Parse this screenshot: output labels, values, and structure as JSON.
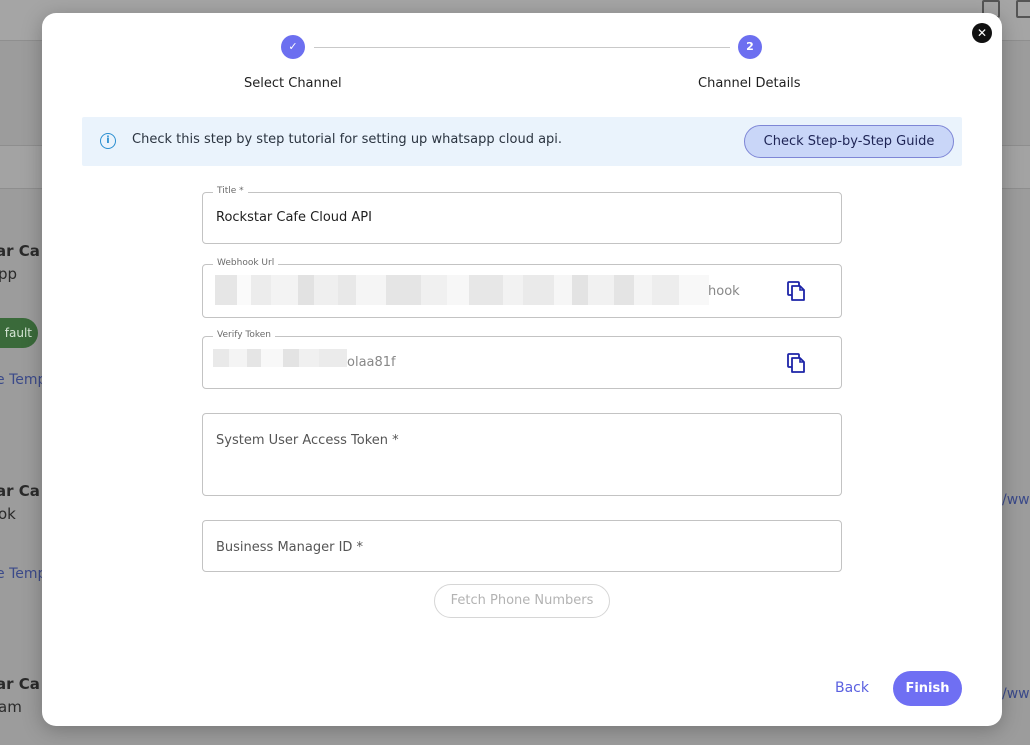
{
  "background": {
    "cards": [
      {
        "title": "ar Ca",
        "subtitle": "pp",
        "link": "e Temp",
        "badge": "fault"
      },
      {
        "title": "ar Ca",
        "subtitle": "ok",
        "link": "e Temp",
        "right_link": "/www"
      },
      {
        "title": "ar Ca",
        "subtitle": "am",
        "right_link": "/www"
      }
    ]
  },
  "modal": {
    "close_label": "✕",
    "stepper": {
      "steps": [
        {
          "label": "Select Channel",
          "marker": "✓",
          "status": "completed"
        },
        {
          "label": "Channel Details",
          "marker": "2",
          "status": "active"
        }
      ]
    },
    "banner": {
      "icon": "info-icon",
      "text": "Check this step by step tutorial for setting up whatsapp cloud api.",
      "button_label": "Check Step-by-Step Guide"
    },
    "fields": {
      "title": {
        "label": "Title *",
        "value": "Rockstar Cafe Cloud API"
      },
      "webhook_url": {
        "label": "Webhook Url",
        "value_visible_suffix": "hook"
      },
      "verify_token": {
        "label": "Verify Token",
        "value_visible_suffix": "olaa81f"
      },
      "system_user_access_token": {
        "placeholder": "System User Access Token *"
      },
      "business_manager_id": {
        "placeholder": "Business Manager ID *"
      }
    },
    "fetch_button_label": "Fetch Phone Numbers",
    "back_label": "Back",
    "finish_label": "Finish",
    "colors": {
      "accent": "#6c6ff0",
      "banner_bg": "#eaf3fc",
      "guide_button_bg": "#c9d6f8",
      "copy_icon": "#1d24a8"
    }
  }
}
